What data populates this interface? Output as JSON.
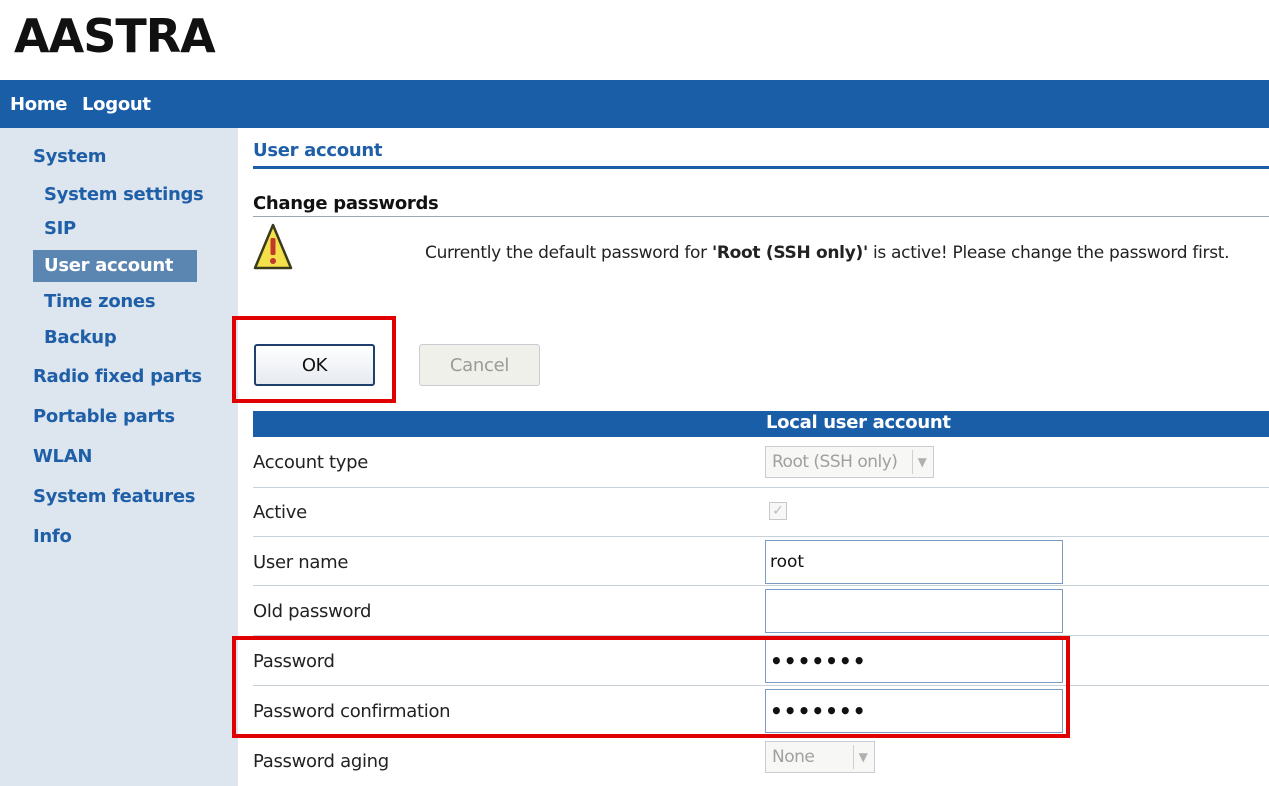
{
  "brand": {
    "logo_text": "AASTRA"
  },
  "topbar": {
    "home": "Home",
    "logout": "Logout"
  },
  "sidebar": {
    "items": [
      {
        "label": "System"
      },
      {
        "label": "System settings"
      },
      {
        "label": "SIP"
      },
      {
        "label": "User account",
        "selected": true
      },
      {
        "label": "Time zones"
      },
      {
        "label": "Backup"
      },
      {
        "label": "Radio fixed parts"
      },
      {
        "label": "Portable parts"
      },
      {
        "label": "WLAN"
      },
      {
        "label": "System features"
      },
      {
        "label": "Info"
      }
    ]
  },
  "main": {
    "section_title": "User account",
    "subsection_title": "Change passwords",
    "warning": {
      "prefix": "Currently the default password for ",
      "emphasis": "'Root (SSH only)'",
      "suffix": " is active! Please change the password first.",
      "icon": "warning-icon"
    },
    "buttons": {
      "ok": "OK",
      "cancel": "Cancel"
    },
    "table_header": "Local user account",
    "rows": {
      "account_type": {
        "label": "Account type",
        "value": "Root (SSH only)"
      },
      "active": {
        "label": "Active",
        "checked": true
      },
      "user_name": {
        "label": "User name",
        "value": "root"
      },
      "old_password": {
        "label": "Old password",
        "value": ""
      },
      "password": {
        "label": "Password",
        "value": "•••••••"
      },
      "password_confirmation": {
        "label": "Password confirmation",
        "value": "•••••••"
      },
      "password_aging": {
        "label": "Password aging",
        "value": "None"
      }
    }
  },
  "colors": {
    "brand_blue": "#1a5ea8",
    "highlight_red": "#e00000",
    "sidebar_bg": "#dde5ee"
  }
}
